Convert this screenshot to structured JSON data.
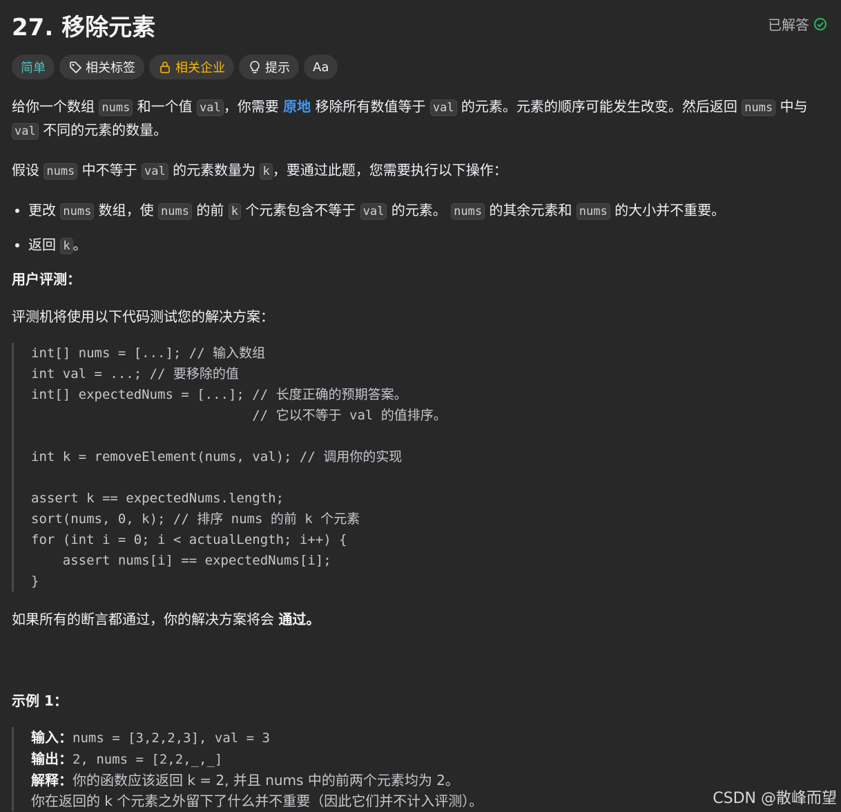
{
  "problem": {
    "title": "27. 移除元素",
    "solved_label": "已解答"
  },
  "tags": [
    {
      "label": "简单"
    },
    {
      "label": "相关标签"
    },
    {
      "label": "相关企业"
    },
    {
      "label": "提示"
    },
    {
      "label": "Aa"
    }
  ],
  "colors": {
    "easy": "#46c6c2",
    "company": "#ffb800",
    "link": "#3c9bf6",
    "solved": "#2cbb5d"
  },
  "desc": {
    "p1_a": "给你一个数组",
    "nums": "nums",
    "p1_b": "和一个值",
    "val": "val",
    "p1_c": "，你需要",
    "in_place": "原地",
    "p1_d": "移除所有数值等于",
    "p1_e": "的元素。元素的顺序可能发生改变。然后返回",
    "p1_f": "中与",
    "p1_g": "不同的元素的数量。",
    "p2_a": "假设",
    "p2_b": "中不等于",
    "p2_c": "的元素数量为",
    "k": "k",
    "p2_d": "，要通过此题，您需要执行以下操作：",
    "li1_a": "更改",
    "li1_b": "数组，使",
    "li1_c": "的前",
    "li1_d": "个元素包含不等于",
    "li1_e": "的元素。",
    "li1_f": "的其余元素和",
    "li1_g": "的大小并不重要。",
    "li2_a": "返回",
    "li2_b": "。",
    "judge_heading": "用户评测：",
    "judge_intro": "评测机将使用以下代码测试您的解决方案：",
    "code": "int[] nums = [...]; // 输入数组\nint val = ...; // 要移除的值\nint[] expectedNums = [...]; // 长度正确的预期答案。\n                            // 它以不等于 val 的值排序。\n\nint k = removeElement(nums, val); // 调用你的实现\n\nassert k == expectedNums.length;\nsort(nums, 0, k); // 排序 nums 的前 k 个元素\nfor (int i = 0; i < actualLength; i++) {\n    assert nums[i] == expectedNums[i];\n}",
    "pass_a": "如果所有的断言都通过，你的解决方案将会",
    "pass_b": "通过。"
  },
  "example": {
    "heading": "示例 1：",
    "input_label": "输入：",
    "input_value": "nums = [3,2,2,3], val = 3",
    "output_label": "输出：",
    "output_value": "2, nums = [2,2,_,_]",
    "explain_label": "解释：",
    "explain_text": "你的函数应该返回 k = 2, 并且 nums 中的前两个元素均为 2。",
    "explain_text2": "你在返回的 k 个元素之外留下了什么并不重要（因此它们并不计入评测）。"
  },
  "watermark": "CSDN @散峰而望"
}
